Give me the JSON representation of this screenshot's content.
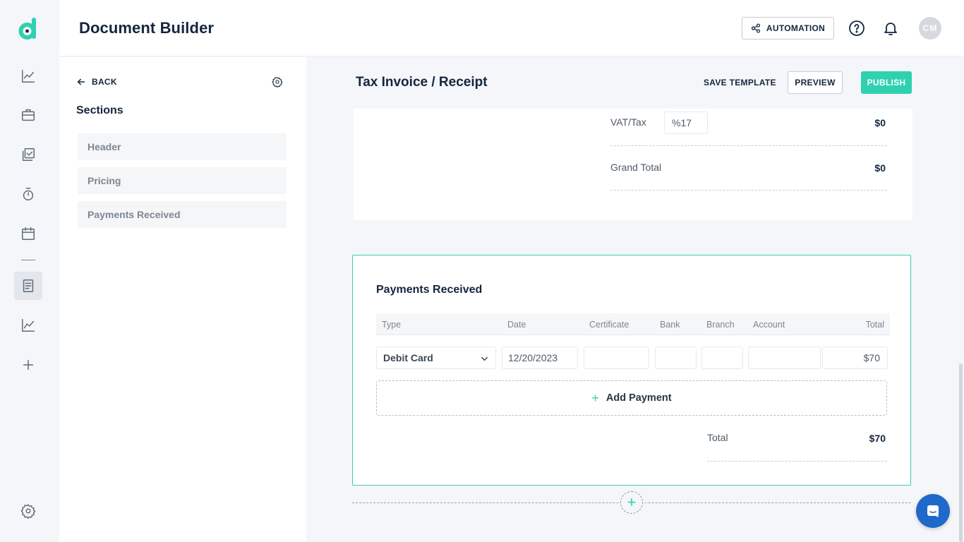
{
  "app": {
    "title": "Document Builder",
    "automation_label": "AUTOMATION",
    "avatar_initials": "CM"
  },
  "sidebar": {
    "back_label": "BACK",
    "sections_title": "Sections",
    "items": [
      {
        "label": "Header"
      },
      {
        "label": "Pricing"
      },
      {
        "label": "Payments Received"
      }
    ]
  },
  "document": {
    "title": "Tax Invoice / Receipt",
    "save_template_label": "SAVE TEMPLATE",
    "preview_label": "PREVIEW",
    "publish_label": "PUBLISH"
  },
  "pricing": {
    "vat_label": "VAT/Tax",
    "vat_value": "%17",
    "vat_amount": "$0",
    "grand_total_label": "Grand Total",
    "grand_total_value": "$0"
  },
  "payments": {
    "title": "Payments Received",
    "columns": [
      "Type",
      "Date",
      "Certificate",
      "Bank",
      "Branch",
      "Account",
      "Total"
    ],
    "row": {
      "type": "Debit Card",
      "date": "12/20/2023",
      "certificate": "",
      "bank": "",
      "branch": "",
      "account": "",
      "total": "$70"
    },
    "add_label": "Add Payment",
    "total_label": "Total",
    "total_value": "$70"
  },
  "colors": {
    "accent": "#2fd1b0",
    "chat": "#1e69c9",
    "text_dark": "#14263d"
  }
}
